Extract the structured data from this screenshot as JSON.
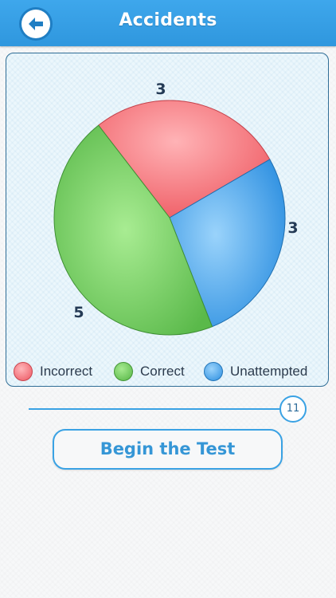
{
  "header": {
    "title": "Accidents",
    "back_icon": "arrow-left-icon",
    "color": "#36a0e8"
  },
  "chart_data": {
    "type": "pie",
    "title": "",
    "slices": [
      {
        "name": "Incorrect",
        "value": 3,
        "color": "#f0606a"
      },
      {
        "name": "Unattempted",
        "value": 3,
        "color": "#3a9ae6"
      },
      {
        "name": "Correct",
        "value": 5,
        "color": "#66c558"
      }
    ],
    "legend": [
      "Incorrect",
      "Correct",
      "Unattempted"
    ],
    "legend_position": "bottom"
  },
  "legend": {
    "incorrect": "Incorrect",
    "correct": "Correct",
    "unattempted": "Unattempted"
  },
  "labels": {
    "incorrect": "3",
    "unattempted": "3",
    "correct": "5"
  },
  "slider": {
    "value": "11",
    "accent": "#3aa2e4"
  },
  "actions": {
    "begin_label": "Begin the Test"
  }
}
